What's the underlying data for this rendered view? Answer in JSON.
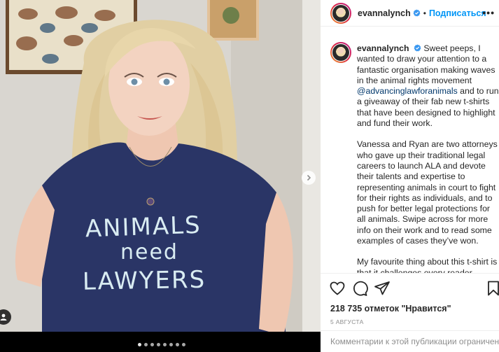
{
  "post": {
    "username": "evannalynch",
    "follow_label": "Подписаться",
    "separator": "•",
    "more_label": "•••",
    "caption": {
      "username": "evannalynch",
      "p1_intro": "Sweet peeps, I wanted to draw your attention to a fantastic organisation making waves in the animal rights movement",
      "mention": "@advancinglawforanimals",
      "p1_rest": "and to run a giveaway of their fab new t-shirts that have been designed to highlight and fund their work.",
      "p2": "Vanessa and Ryan are two attorneys who gave up their traditional legal careers to launch ALA and devote their talents and expertise to representing animals in court to fight for their rights as individuals, and to push for better legal protections for all animals. Swipe across for more info on their work and to read some examples of cases they’ve won.",
      "p3": "My favourite thing about this t-shirt is that it challenges every reader (basically everyone you walk by) to ask themselves why animals might need legal"
    },
    "likes": "218 735 отметок \"Нравится\"",
    "date": "5 АВГУСТА",
    "comments_disabled": "Комментарии к этой публикации ограничены."
  },
  "photo": {
    "shirt_text_line1": "ANIMALS",
    "shirt_text_line2": "need",
    "shirt_text_line3": "LAWYERS",
    "carousel_count": 8,
    "carousel_active": 1
  },
  "icons": {
    "verified": "verified-badge-icon",
    "like": "heart-icon",
    "comment": "comment-icon",
    "share": "paper-plane-icon",
    "save": "bookmark-icon",
    "next": "chevron-right-icon",
    "tag": "user-tag-icon"
  },
  "colors": {
    "accent": "#0095f6",
    "mention": "#00376b",
    "shirt": "#2a3566",
    "text_muted": "#8e8e8e"
  }
}
